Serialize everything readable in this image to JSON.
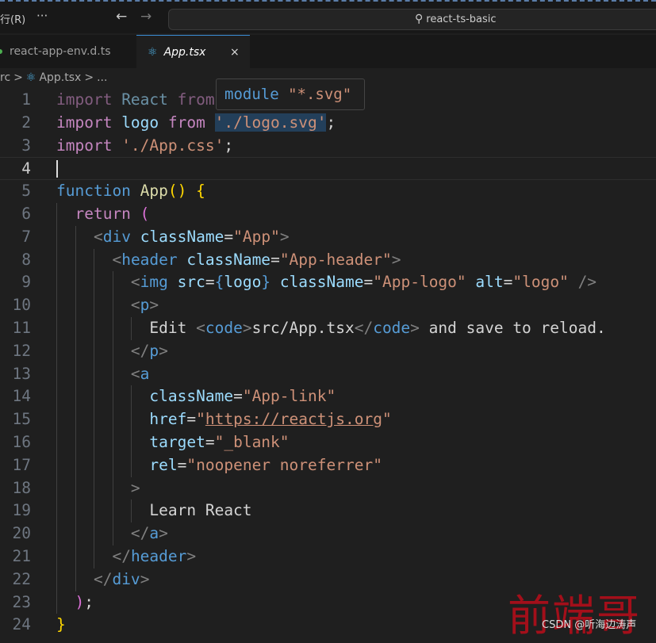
{
  "titlebar": {
    "menu": "行(R)",
    "more": "···",
    "back_icon": "←",
    "forward_icon": "→",
    "search_text": "react-ts-basic",
    "search_icon": "⚲"
  },
  "tabs": [
    {
      "label": "react-app-env.d.ts"
    },
    {
      "label": "App.tsx",
      "close": "×",
      "active": true
    }
  ],
  "breadcrumb": {
    "items": [
      "rc",
      ">",
      "App.tsx",
      ">",
      "..."
    ],
    "react_icon": "⚛"
  },
  "hover": {
    "kw": "module",
    "str": "\"*.svg\""
  },
  "editor": {
    "current_line": 4,
    "lines": [
      {
        "n": "1",
        "ind": 0,
        "t": [
          [
            "import ",
            "k d"
          ],
          [
            "React ",
            "v d"
          ],
          [
            "from ",
            "k d"
          ]
        ]
      },
      {
        "n": "2",
        "ind": 0,
        "t": [
          [
            "import ",
            "k"
          ],
          [
            "logo ",
            "v"
          ],
          [
            "from ",
            "k"
          ],
          [
            "'./logo.svg'",
            "s hl"
          ],
          [
            ";",
            "p"
          ]
        ]
      },
      {
        "n": "3",
        "ind": 0,
        "t": [
          [
            "import ",
            "k"
          ],
          [
            "'./App.css'",
            "s"
          ],
          [
            ";",
            "p"
          ]
        ]
      },
      {
        "n": "4",
        "ind": 0,
        "t": []
      },
      {
        "n": "5",
        "ind": 0,
        "t": [
          [
            "function ",
            "b"
          ],
          [
            "App",
            "f"
          ],
          [
            "()",
            "y"
          ],
          [
            " ",
            "p"
          ],
          [
            "{",
            "y"
          ]
        ]
      },
      {
        "n": "6",
        "ind": 1,
        "t": [
          [
            "  return ",
            "k"
          ],
          [
            "(",
            "m"
          ]
        ]
      },
      {
        "n": "7",
        "ind": 2,
        "t": [
          [
            "    ",
            "p"
          ],
          [
            "<",
            "g"
          ],
          [
            "div ",
            "b"
          ],
          [
            "className",
            "v"
          ],
          [
            "=",
            "p"
          ],
          [
            "\"App\"",
            "s"
          ],
          [
            ">",
            "g"
          ]
        ]
      },
      {
        "n": "8",
        "ind": 3,
        "t": [
          [
            "      ",
            "p"
          ],
          [
            "<",
            "g"
          ],
          [
            "header ",
            "b"
          ],
          [
            "className",
            "v"
          ],
          [
            "=",
            "p"
          ],
          [
            "\"App-header\"",
            "s"
          ],
          [
            ">",
            "g"
          ]
        ]
      },
      {
        "n": "9",
        "ind": 4,
        "t": [
          [
            "        ",
            "p"
          ],
          [
            "<",
            "g"
          ],
          [
            "img ",
            "b"
          ],
          [
            "src",
            "v"
          ],
          [
            "=",
            "p"
          ],
          [
            "{",
            "b"
          ],
          [
            "logo",
            "v"
          ],
          [
            "} ",
            "b"
          ],
          [
            "className",
            "v"
          ],
          [
            "=",
            "p"
          ],
          [
            "\"App-logo\" ",
            "s"
          ],
          [
            "alt",
            "v"
          ],
          [
            "=",
            "p"
          ],
          [
            "\"logo\" ",
            "s"
          ],
          [
            "/>",
            "g"
          ]
        ]
      },
      {
        "n": "10",
        "ind": 4,
        "t": [
          [
            "        ",
            "p"
          ],
          [
            "<",
            "g"
          ],
          [
            "p",
            "b"
          ],
          [
            ">",
            "g"
          ]
        ]
      },
      {
        "n": "11",
        "ind": 5,
        "t": [
          [
            "          Edit ",
            "p"
          ],
          [
            "<",
            "g"
          ],
          [
            "code",
            "b"
          ],
          [
            ">",
            "g"
          ],
          [
            "src/App.tsx",
            "p"
          ],
          [
            "</",
            "g"
          ],
          [
            "code",
            "b"
          ],
          [
            ">",
            "g"
          ],
          [
            " and save to reload.",
            "p"
          ]
        ]
      },
      {
        "n": "12",
        "ind": 4,
        "t": [
          [
            "        ",
            "p"
          ],
          [
            "</",
            "g"
          ],
          [
            "p",
            "b"
          ],
          [
            ">",
            "g"
          ]
        ]
      },
      {
        "n": "13",
        "ind": 4,
        "t": [
          [
            "        ",
            "p"
          ],
          [
            "<",
            "g"
          ],
          [
            "a",
            "b"
          ]
        ]
      },
      {
        "n": "14",
        "ind": 5,
        "t": [
          [
            "          ",
            "p"
          ],
          [
            "className",
            "v"
          ],
          [
            "=",
            "p"
          ],
          [
            "\"App-link\"",
            "s"
          ]
        ]
      },
      {
        "n": "15",
        "ind": 5,
        "t": [
          [
            "          ",
            "p"
          ],
          [
            "href",
            "v"
          ],
          [
            "=",
            "p"
          ],
          [
            "\"",
            "s"
          ],
          [
            "https://reactjs.org",
            "s u"
          ],
          [
            "\"",
            "s"
          ]
        ]
      },
      {
        "n": "16",
        "ind": 5,
        "t": [
          [
            "          ",
            "p"
          ],
          [
            "target",
            "v"
          ],
          [
            "=",
            "p"
          ],
          [
            "\"_blank\"",
            "s"
          ]
        ]
      },
      {
        "n": "17",
        "ind": 5,
        "t": [
          [
            "          ",
            "p"
          ],
          [
            "rel",
            "v"
          ],
          [
            "=",
            "p"
          ],
          [
            "\"noopener noreferrer\"",
            "s"
          ]
        ]
      },
      {
        "n": "18",
        "ind": 4,
        "t": [
          [
            "        ",
            "p"
          ],
          [
            ">",
            "g"
          ]
        ]
      },
      {
        "n": "19",
        "ind": 5,
        "t": [
          [
            "          Learn React",
            "p"
          ]
        ]
      },
      {
        "n": "20",
        "ind": 4,
        "t": [
          [
            "        ",
            "p"
          ],
          [
            "</",
            "g"
          ],
          [
            "a",
            "b"
          ],
          [
            ">",
            "g"
          ]
        ]
      },
      {
        "n": "21",
        "ind": 3,
        "t": [
          [
            "      ",
            "p"
          ],
          [
            "</",
            "g"
          ],
          [
            "header",
            "b"
          ],
          [
            ">",
            "g"
          ]
        ]
      },
      {
        "n": "22",
        "ind": 2,
        "t": [
          [
            "    ",
            "p"
          ],
          [
            "</",
            "g"
          ],
          [
            "div",
            "b"
          ],
          [
            ">",
            "g"
          ]
        ]
      },
      {
        "n": "23",
        "ind": 1,
        "t": [
          [
            "  ",
            "p"
          ],
          [
            ")",
            "m"
          ],
          [
            ";",
            "p"
          ]
        ]
      },
      {
        "n": "24",
        "ind": 0,
        "t": [
          [
            "}",
            "y"
          ]
        ]
      }
    ]
  },
  "watermark": {
    "logo": "前端哥",
    "credit": "CSDN @听海边涛声"
  }
}
